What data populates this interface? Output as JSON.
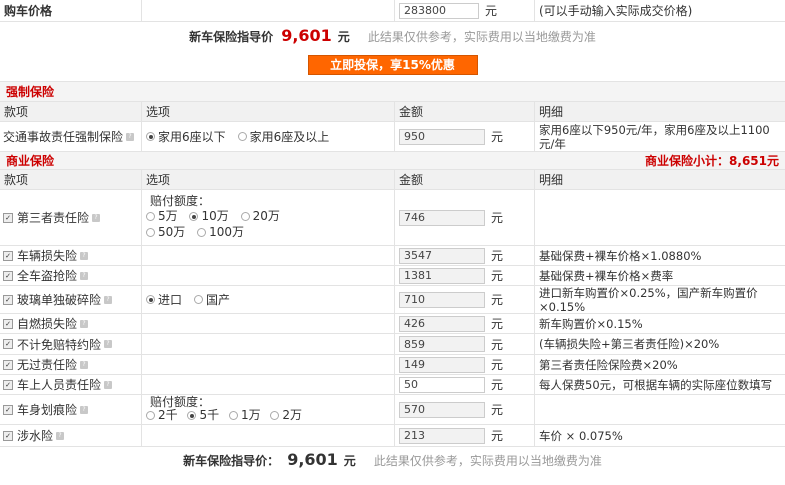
{
  "car_price": {
    "label": "购车价格",
    "value": "283800",
    "unit": "元",
    "hint": "(可以手动输入实际成交价格)"
  },
  "guide_top": {
    "label": "新车保险指导价",
    "amount": "9,601",
    "unit": "元",
    "note": "此结果仅供参考，实际费用以当地缴费为准"
  },
  "cta": {
    "label": "立即投保，享15%优惠"
  },
  "compulsory": {
    "title": "强制保险",
    "headers": {
      "item": "款项",
      "option": "选项",
      "amount": "金额",
      "detail": "明细"
    },
    "row": {
      "name": "交通事故责任强制保险",
      "opt1": "家用6座以下",
      "opt2": "家用6座及以上",
      "value": "950",
      "unit": "元",
      "detail": "家用6座以下950元/年，家用6座及以上1100元/年"
    }
  },
  "commercial": {
    "title": "商业保险",
    "subtotal": "商业保险小计：8,651元",
    "headers": {
      "item": "款项",
      "option": "选项",
      "amount": "金额",
      "detail": "明细"
    },
    "third_party": {
      "name": "第三者责任险",
      "label": "赔付额度：",
      "opts": [
        "5万",
        "10万",
        "20万",
        "50万",
        "100万"
      ],
      "value": "746",
      "unit": "元"
    },
    "rows": [
      {
        "name": "车辆损失险",
        "value": "3547",
        "unit": "元",
        "detail": "基础保费+裸车价格×1.0880%"
      },
      {
        "name": "全车盗抢险",
        "value": "1381",
        "unit": "元",
        "detail": "基础保费+裸车价格×费率"
      }
    ],
    "glass": {
      "name": "玻璃单独破碎险",
      "opt1": "进口",
      "opt2": "国产",
      "value": "710",
      "unit": "元",
      "detail": "进口新车购置价×0.25%，国产新车购置价×0.15%"
    },
    "rows2": [
      {
        "name": "自燃损失险",
        "value": "426",
        "unit": "元",
        "detail": "新车购置价×0.15%"
      },
      {
        "name": "不计免赔特约险",
        "value": "859",
        "unit": "元",
        "detail": "(车辆损失险+第三者责任险)×20%"
      },
      {
        "name": "无过责任险",
        "value": "149",
        "unit": "元",
        "detail": "第三者责任险保险费×20%"
      },
      {
        "name": "车上人员责任险",
        "value": "50",
        "unit": "元",
        "detail": "每人保费50元，可根据车辆的实际座位数填写"
      }
    ],
    "scratch": {
      "name": "车身划痕险",
      "label": "赔付额度：",
      "opts": [
        "2千",
        "5千",
        "1万",
        "2万"
      ],
      "value": "570",
      "unit": "元"
    },
    "wading": {
      "name": "涉水险",
      "value": "213",
      "unit": "元",
      "detail": "车价 × 0.075%"
    }
  },
  "guide_bottom": {
    "label": "新车保险指导价：",
    "amount": "9,601",
    "unit": "元",
    "note": "此结果仅供参考，实际费用以当地缴费为准"
  }
}
